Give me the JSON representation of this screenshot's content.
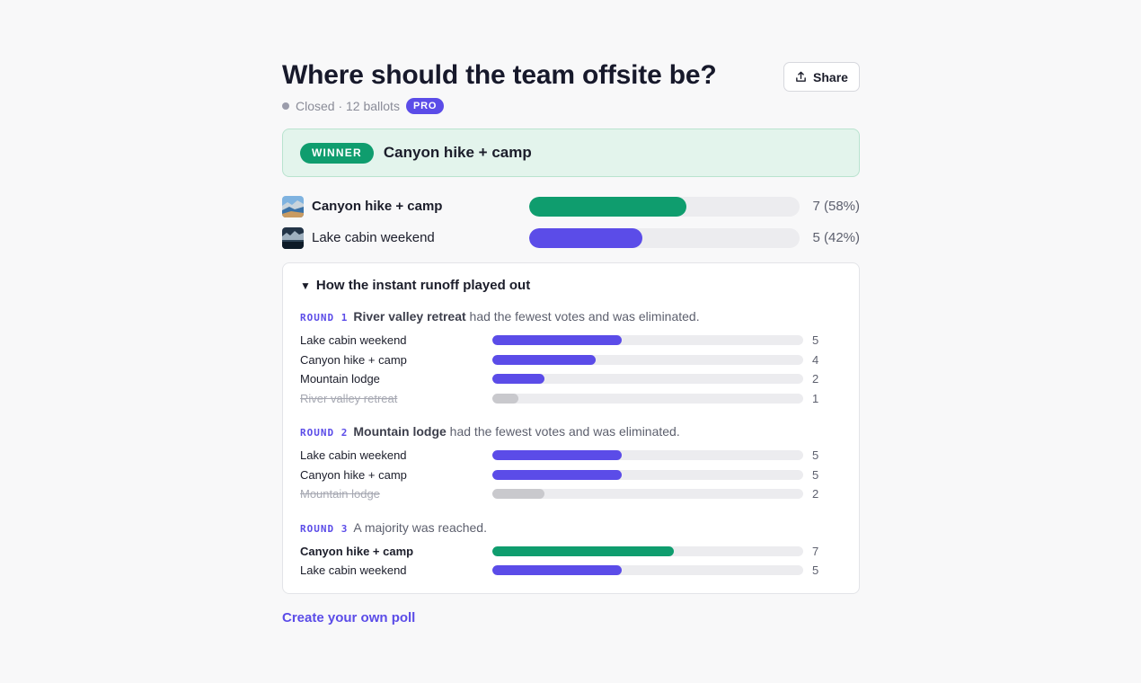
{
  "poll": {
    "title": "Where should the team offsite be?",
    "share_label": "Share",
    "status": "Closed · 12 ballots",
    "badge": "PRO"
  },
  "winner": {
    "pill": "WINNER",
    "name": "Canyon hike + camp"
  },
  "results": [
    {
      "name": "Canyon hike + camp",
      "count": "7 (58%)",
      "fraction": 0.58,
      "color": "#0f9d6e",
      "thumb": "canyon-thumbnail",
      "bold": true
    },
    {
      "name": "Lake cabin weekend",
      "count": "5 (42%)",
      "fraction": 0.42,
      "color": "#5b4ce8",
      "thumb": "lake-thumbnail",
      "bold": false
    }
  ],
  "runoff": {
    "summary": "How the instant runoff played out",
    "rounds": [
      {
        "label": "ROUND 1",
        "highlight": "River valley retreat",
        "text": " had the fewest votes and was eliminated.",
        "rows": [
          {
            "name": "Lake cabin weekend",
            "votes": 5,
            "state": "active"
          },
          {
            "name": "Canyon hike + camp",
            "votes": 4,
            "state": "active"
          },
          {
            "name": "Mountain lodge",
            "votes": 2,
            "state": "active"
          },
          {
            "name": "River valley retreat",
            "votes": 1,
            "state": "eliminated"
          }
        ]
      },
      {
        "label": "ROUND 2",
        "highlight": "Mountain lodge",
        "text": " had the fewest votes and was eliminated.",
        "rows": [
          {
            "name": "Lake cabin weekend",
            "votes": 5,
            "state": "active"
          },
          {
            "name": "Canyon hike + camp",
            "votes": 5,
            "state": "active"
          },
          {
            "name": "Mountain lodge",
            "votes": 2,
            "state": "eliminated"
          }
        ]
      },
      {
        "label": "ROUND 3",
        "highlight": "",
        "text": "A majority was reached.",
        "rows": [
          {
            "name": "Canyon hike + camp",
            "votes": 7,
            "state": "winner"
          },
          {
            "name": "Lake cabin weekend",
            "votes": 5,
            "state": "active"
          }
        ]
      }
    ],
    "max_votes": 12
  },
  "colors": {
    "accent": "#5b4ce8",
    "winner": "#0f9d6e",
    "eliminated": "#c9c9cd"
  },
  "footer": {
    "create_link": "Create your own poll"
  }
}
